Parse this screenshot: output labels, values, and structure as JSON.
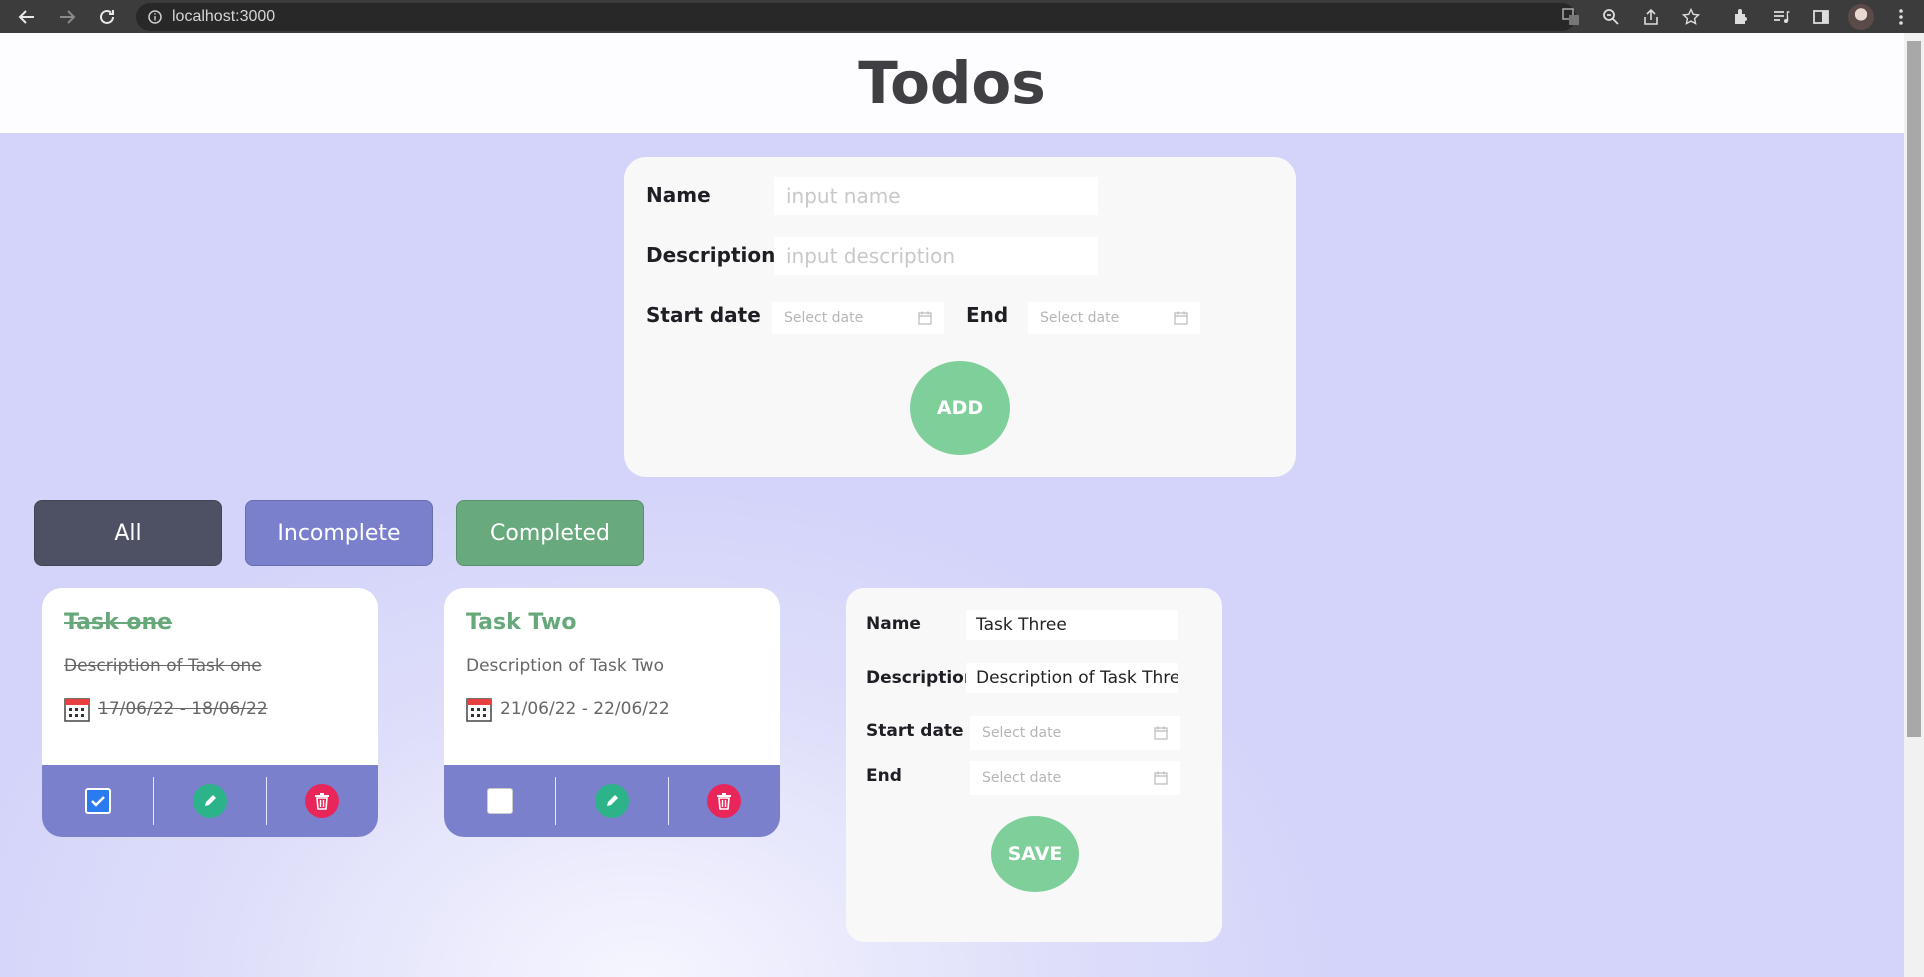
{
  "browser": {
    "url": "localhost:3000"
  },
  "header": {
    "title": "Todos"
  },
  "add_form": {
    "name_label": "Name",
    "name_placeholder": "input name",
    "description_label": "Description",
    "description_placeholder": "input description",
    "start_label": "Start date",
    "start_placeholder": "Select date",
    "end_label": "End",
    "end_placeholder": "Select date",
    "add_label": "ADD"
  },
  "filters": [
    {
      "label": "All",
      "color": "#4e5063"
    },
    {
      "label": "Incomplete",
      "color": "#7b80cd"
    },
    {
      "label": "Completed",
      "color": "#68aa7e"
    }
  ],
  "tasks": [
    {
      "title": "Task one",
      "description": "Description of Task one",
      "dates": "17/06/22 - 18/06/22",
      "completed": true
    },
    {
      "title": "Task Two",
      "description": "Description of Task Two",
      "dates": "21/06/22 - 22/06/22",
      "completed": false
    }
  ],
  "edit_form": {
    "name_label": "Name",
    "name_value": "Task Three",
    "description_label": "Description",
    "description_value": "Description of Task Three",
    "start_label": "Start date",
    "start_placeholder": "Select date",
    "end_label": "End",
    "end_placeholder": "Select date",
    "save_label": "SAVE"
  },
  "colors": {
    "accent_green": "#7fcf9a",
    "task_footer": "#7b80cd",
    "edit_icon": "#2db38a",
    "delete_icon": "#e8265a",
    "checkbox_checked": "#2b7bf0"
  }
}
